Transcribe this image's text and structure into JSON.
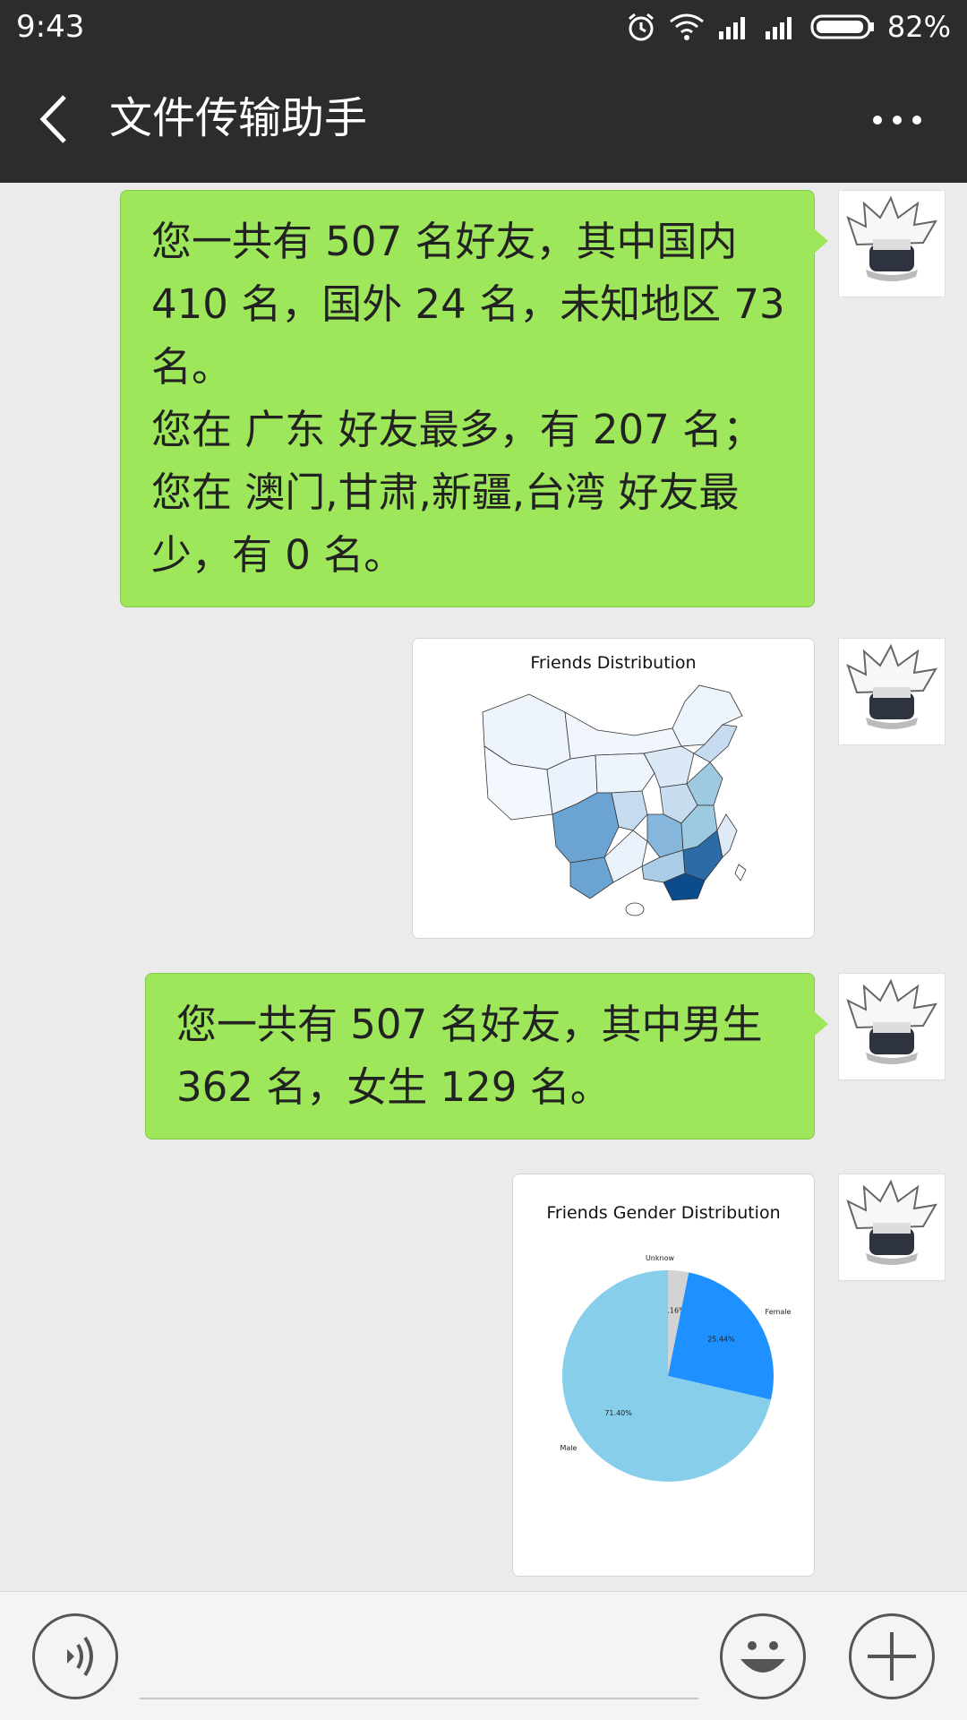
{
  "status_bar": {
    "time": "9:43",
    "battery": "82%"
  },
  "header": {
    "title": "文件传输助手"
  },
  "messages": {
    "m1": {
      "lines": [
        "您一共有 507 名好友，其中国内",
        "410 名，国外 24 名，未知地区 73",
        "名。",
        "您在 广东 好友最多，有 207 名；",
        "您在 澳门,甘肃,新疆,台湾 好友最",
        "少，有 0 名。"
      ]
    },
    "m2": {
      "image_title": "Friends Distribution"
    },
    "m3": {
      "lines": [
        "您一共有 507 名好友，其中男生",
        "362 名，女生 129 名。"
      ]
    },
    "m4": {
      "image_title": "Friends Gender Distribution"
    }
  },
  "chart_data": {
    "type": "pie",
    "title": "Friends Gender Distribution",
    "slices": [
      {
        "label": "Unknow",
        "value": 3.16,
        "pct_label": "3.16%",
        "color": "#d3d3d3"
      },
      {
        "label": "Female",
        "value": 25.44,
        "pct_label": "25.44%",
        "color": "#1e90ff"
      },
      {
        "label": "Male",
        "value": 71.4,
        "pct_label": "71.40%",
        "color": "#87ceeb"
      }
    ],
    "start": "top",
    "direction": "clockwise"
  },
  "colors": {
    "bar_bg": "#2c2c2c",
    "bubble_green": "#9ee65a",
    "chat_bg": "#ebebeb"
  },
  "icons": {
    "back": "chevron-left-icon",
    "more": "more-dots-icon",
    "voice": "voice-icon",
    "emoji": "emoji-icon",
    "add": "plus-icon"
  }
}
